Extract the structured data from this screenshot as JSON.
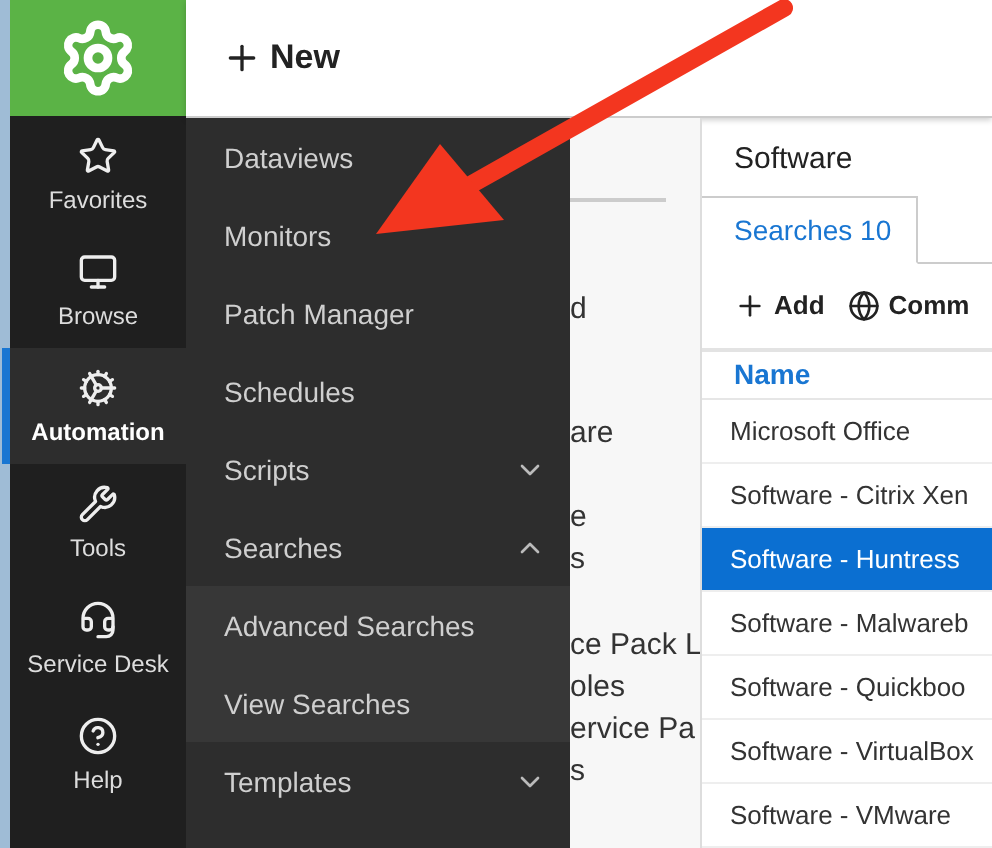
{
  "header": {
    "new_button": "New"
  },
  "nav": [
    {
      "label": "Favorites",
      "selected": false
    },
    {
      "label": "Browse",
      "selected": false
    },
    {
      "label": "Automation",
      "selected": true
    },
    {
      "label": "Tools",
      "selected": false
    },
    {
      "label": "Service Desk",
      "selected": false
    },
    {
      "label": "Help",
      "selected": false
    }
  ],
  "flyout": [
    {
      "label": "Dataviews",
      "kind": "link"
    },
    {
      "label": "Monitors",
      "kind": "link"
    },
    {
      "label": "Patch Manager",
      "kind": "link"
    },
    {
      "label": "Schedules",
      "kind": "link"
    },
    {
      "label": "Scripts",
      "kind": "group",
      "expanded": false
    },
    {
      "label": "Searches",
      "kind": "group",
      "expanded": true,
      "children": [
        {
          "label": "Advanced Searches"
        },
        {
          "label": "View Searches"
        }
      ]
    },
    {
      "label": "Templates",
      "kind": "group",
      "expanded": false
    }
  ],
  "middle_fragments": [
    {
      "lines": [
        "d"
      ]
    },
    {
      "lines": [
        "are"
      ]
    },
    {
      "lines": [
        "e",
        "s"
      ]
    },
    {
      "lines": [
        "ce Pack L",
        "oles",
        "ervice Pa",
        "s"
      ]
    }
  ],
  "panel": {
    "title": "Software",
    "tabs": [
      {
        "label": "Searches 10",
        "selected": true
      }
    ],
    "toolbar": [
      "Add",
      "Comm"
    ],
    "columns": [
      "Name"
    ],
    "rows": [
      {
        "name": "Microsoft Office",
        "selected": false
      },
      {
        "name": "Software - Citrix Xen",
        "selected": false
      },
      {
        "name": "Software - Huntress",
        "selected": true
      },
      {
        "name": "Software - Malwareb",
        "selected": false
      },
      {
        "name": "Software - Quickboo",
        "selected": false
      },
      {
        "name": "Software - VirtualBox",
        "selected": false
      },
      {
        "name": "Software - VMware",
        "selected": false
      }
    ]
  }
}
